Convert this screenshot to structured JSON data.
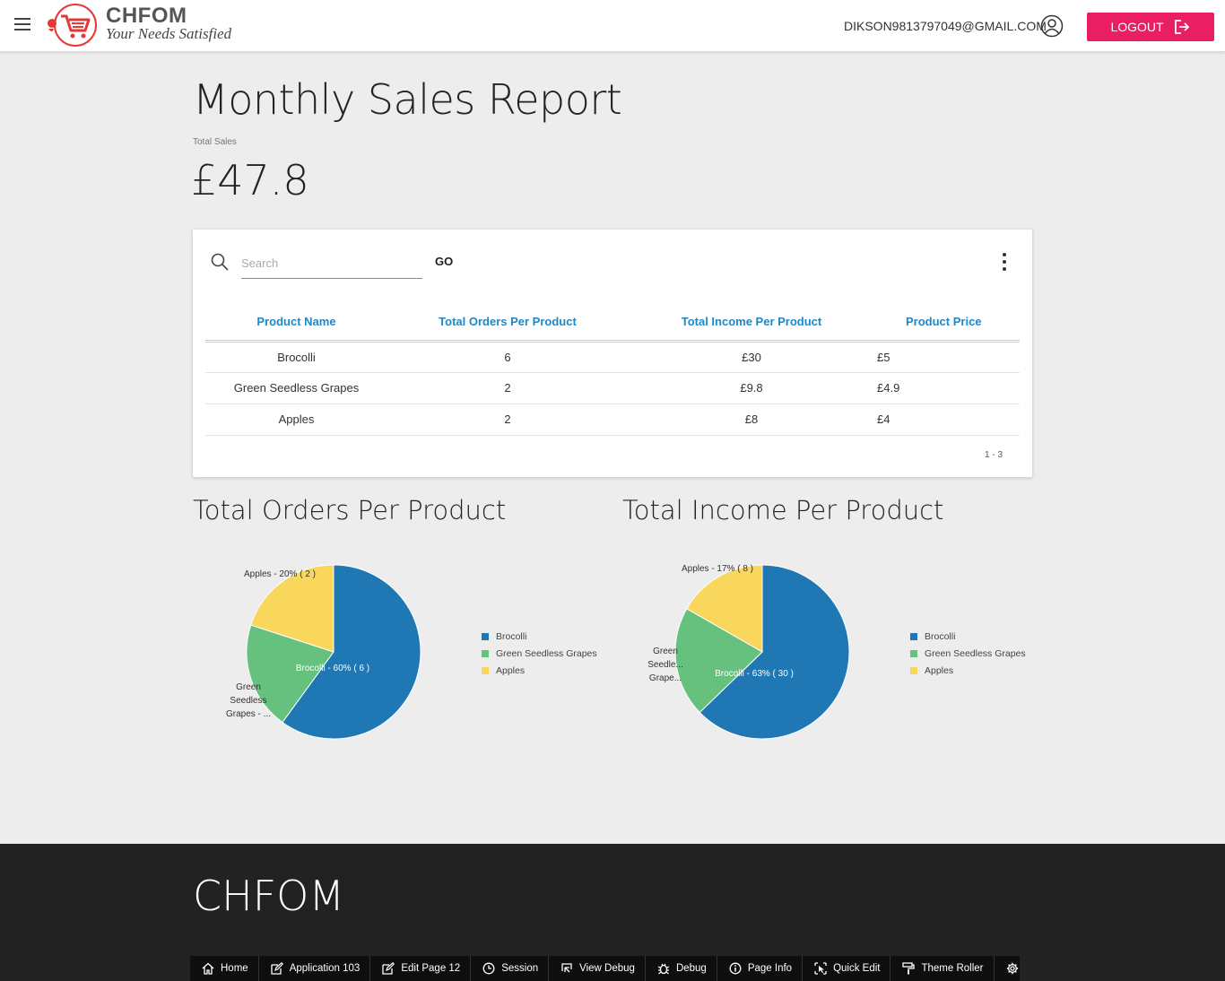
{
  "header": {
    "brand_name": "CHFOM",
    "brand_tagline": "Your Needs Satisfied",
    "user_email": "DIKSON9813797049@GMAIL.COM",
    "logout_label": "LOGOUT"
  },
  "page": {
    "title": "Monthly Sales Report",
    "total_label": "Total Sales",
    "total_value": "£47.8"
  },
  "report": {
    "search_placeholder": "Search",
    "go_label": "GO",
    "columns": [
      "Product Name",
      "Total Orders Per Product",
      "Total Income Per Product",
      "Product Price"
    ],
    "rows": [
      [
        "Brocolli",
        "6",
        "£30",
        "£5"
      ],
      [
        "Green Seedless Grapes",
        "2",
        "£9.8",
        "£4.9"
      ],
      [
        "Apples",
        "2",
        "£8",
        "£4"
      ]
    ],
    "pagination": "1 - 3"
  },
  "chart_data": [
    {
      "type": "pie",
      "title": "Total Orders Per Product",
      "categories": [
        "Brocolli",
        "Green Seedless Grapes",
        "Apples"
      ],
      "values": [
        6,
        2,
        2
      ],
      "colors": [
        "#1f77b4",
        "#67c17e",
        "#f9d65c"
      ],
      "slice_labels": [
        "Brocolli - 60% ( 6 )",
        "Green Seedless Grapes - ...",
        "Apples - 20% ( 2 )"
      ],
      "legend": [
        "Brocolli",
        "Green Seedless Grapes",
        "Apples"
      ],
      "legend_position": "right"
    },
    {
      "type": "pie",
      "title": "Total Income Per Product",
      "categories": [
        "Brocolli",
        "Green Seedless Grapes",
        "Apples"
      ],
      "values": [
        30,
        9.8,
        8
      ],
      "colors": [
        "#1f77b4",
        "#67c17e",
        "#f9d65c"
      ],
      "slice_labels": [
        "Brocolli - 63% ( 30 )",
        "Green Seedle... Grape...",
        "Apples - 17% ( 8 )"
      ],
      "legend": [
        "Brocolli",
        "Green Seedless Grapes",
        "Apples"
      ],
      "legend_position": "right"
    }
  ],
  "footer": {
    "brand": "CHFOM",
    "devbar": [
      {
        "label": "Home",
        "icon": "home-icon"
      },
      {
        "label": "Application 103",
        "icon": "edit-icon"
      },
      {
        "label": "Edit Page 12",
        "icon": "edit-icon"
      },
      {
        "label": "Session",
        "icon": "clock-icon"
      },
      {
        "label": "View Debug",
        "icon": "view-debug-icon"
      },
      {
        "label": "Debug",
        "icon": "bug-icon"
      },
      {
        "label": "Page Info",
        "icon": "info-icon"
      },
      {
        "label": "Quick Edit",
        "icon": "quick-edit-icon"
      },
      {
        "label": "Theme Roller",
        "icon": "paint-roller-icon"
      },
      {
        "label": "",
        "icon": "gear-icon"
      }
    ]
  }
}
